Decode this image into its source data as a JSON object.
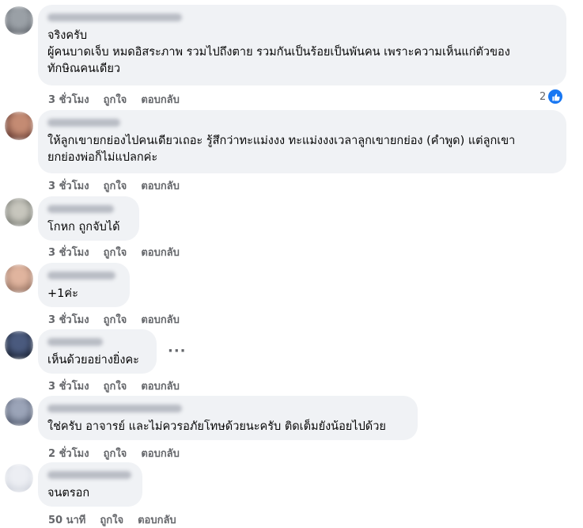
{
  "comments": [
    {
      "text": "จริงครับ\nผู้คนบาดเจ็บ หมดอิสระภาพ รวมไปถึงตาย รวมกันเป็นร้อยเป็นพันคน เพราะความเห็นแก่ตัวของ\nทักษิณคนเดียว",
      "time": "3 ชั่วโมง",
      "like": "ถูกใจ",
      "reply": "ตอบกลับ",
      "reaction_count": "2"
    },
    {
      "text": "ให้ลูกเขายกย่องไปคนเดียวเถอะ รู้สึกว่าทะแม่งงง ทะแม่งงงเวลาลูกเขายกย่อง (คำพูด) แต่ลูกเขา\nยกย่องพ่อก็ไม่แปลกค่ะ",
      "time": "3 ชั่วโมง",
      "like": "ถูกใจ",
      "reply": "ตอบกลับ"
    },
    {
      "text": "โกหก ถูกจับได้",
      "time": "3 ชั่วโมง",
      "like": "ถูกใจ",
      "reply": "ตอบกลับ"
    },
    {
      "text": "+1ค่ะ",
      "time": "3 ชั่วโมง",
      "like": "ถูกใจ",
      "reply": "ตอบกลับ"
    },
    {
      "text": "เห็นด้วยอย่างยิ่งคะ",
      "time": "3 ชั่วโมง",
      "like": "ถูกใจ",
      "reply": "ตอบกลับ",
      "more": "···"
    },
    {
      "text": "ใช่ครับ อาจารย์ และไม่ควรอภัยโทษด้วยนะครับ ติดเต็มยังน้อยไปด้วย",
      "time": "2 ชั่วโมง",
      "like": "ถูกใจ",
      "reply": "ตอบกลับ"
    },
    {
      "text": "จนตรอก",
      "time": "50 นาที",
      "like": "ถูกใจ",
      "reply": "ตอบกลับ"
    }
  ],
  "colors": {
    "bubble": "#f0f2f5",
    "meta_text": "#65676b",
    "like_blue": "#1877f2",
    "avatars": [
      "#7a7f86",
      "#8a5a4e",
      "#9a9c95",
      "#b78f7c",
      "#2d3a55",
      "#6e7890",
      "#d9dde6"
    ]
  },
  "icons": {
    "reaction": "thumbs-up-icon",
    "more": "more-options-icon"
  }
}
